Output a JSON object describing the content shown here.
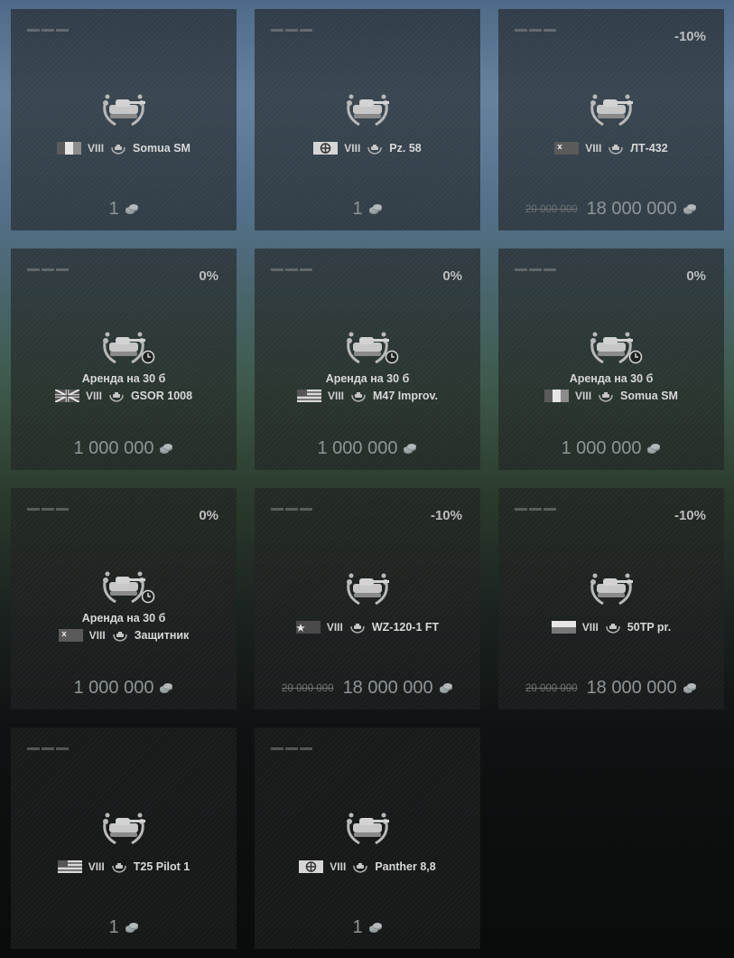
{
  "cards": [
    {
      "discount": "",
      "rental": "",
      "flag": "france",
      "tier": "VIII",
      "vehicle": "Somua SM",
      "old_price": "",
      "price": "1"
    },
    {
      "discount": "",
      "rental": "",
      "flag": "germany",
      "tier": "VIII",
      "vehicle": "Pz. 58",
      "old_price": "",
      "price": "1"
    },
    {
      "discount": "-10%",
      "rental": "",
      "flag": "ussr",
      "tier": "VIII",
      "vehicle": "ЛТ-432",
      "old_price": "20 000 000",
      "price": "18 000 000"
    },
    {
      "discount": "0%",
      "rental": "Аренда на 30 б",
      "flag": "uk",
      "tier": "VIII",
      "vehicle": "GSOR 1008",
      "old_price": "",
      "price": "1 000 000"
    },
    {
      "discount": "0%",
      "rental": "Аренда на 30 б",
      "flag": "usa",
      "tier": "VIII",
      "vehicle": "M47 Improv.",
      "old_price": "",
      "price": "1 000 000"
    },
    {
      "discount": "0%",
      "rental": "Аренда на 30 б",
      "flag": "france",
      "tier": "VIII",
      "vehicle": "Somua SM",
      "old_price": "",
      "price": "1 000 000"
    },
    {
      "discount": "0%",
      "rental": "Аренда на 30 б",
      "flag": "ussr",
      "tier": "VIII",
      "vehicle": "Защитник",
      "old_price": "",
      "price": "1 000 000"
    },
    {
      "discount": "-10%",
      "rental": "",
      "flag": "china",
      "tier": "VIII",
      "vehicle": "WZ-120-1 FT",
      "old_price": "20 000 000",
      "price": "18 000 000"
    },
    {
      "discount": "-10%",
      "rental": "",
      "flag": "poland",
      "tier": "VIII",
      "vehicle": "50TP pr.",
      "old_price": "20 000 000",
      "price": "18 000 000"
    },
    {
      "discount": "",
      "rental": "",
      "flag": "usa",
      "tier": "VIII",
      "vehicle": "T25 Pilot 1",
      "old_price": "",
      "price": "1"
    },
    {
      "discount": "",
      "rental": "",
      "flag": "germany",
      "tier": "VIII",
      "vehicle": "Panther 8,8",
      "old_price": "",
      "price": "1"
    }
  ],
  "icons": {
    "card_mark": "tank-rank-bar-icon",
    "emblem": "tank-wreath-emblem-icon",
    "rental": "clock-icon",
    "premium": "premium-tank-icon",
    "currency": "credits-icon"
  },
  "colors": {
    "text": "#d8d8d8",
    "price": "#8e9596",
    "old_price": "#6e7374",
    "discount": "#bdbdbd"
  }
}
